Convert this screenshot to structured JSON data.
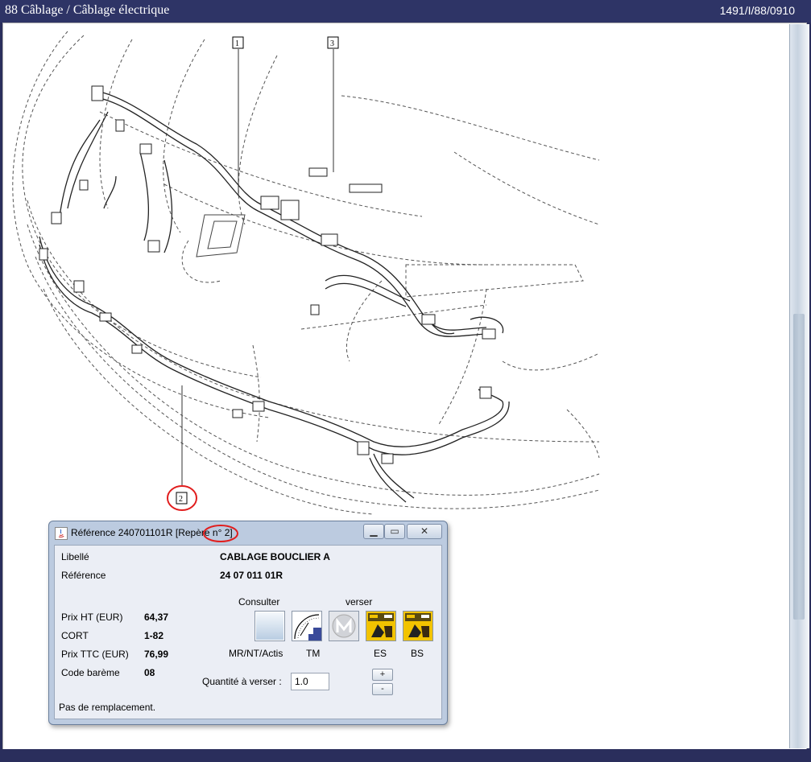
{
  "window": {
    "title_left": "88 Câblage / Câblage électrique",
    "title_right": "1491/I/88/0910"
  },
  "drawing": {
    "callouts": [
      "1",
      "2",
      "3"
    ],
    "highlight_color": "#e11d1d"
  },
  "dialog": {
    "title": "Référence 240701101R [Repère n° 2]",
    "fields": {
      "libelle_label": "Libellé",
      "libelle_value": "CABLAGE BOUCLIER A",
      "reference_label": "Référence",
      "reference_value": "24 07 011 01R",
      "prix_ht_label": "Prix HT (EUR)",
      "prix_ht_value": "64,37",
      "cort_label": "CORT",
      "cort_value": "1-82",
      "prix_ttc_label": "Prix TTC (EUR)",
      "prix_ttc_value": "76,99",
      "code_bareme_label": "Code barème",
      "code_bareme_value": "08"
    },
    "consulter_label": "Consulter",
    "verser_label": "verser",
    "buttons": [
      {
        "label": "MR/NT/Actis",
        "icon": "mr-nt-actis-icon"
      },
      {
        "label": "TM",
        "icon": "gauge-icon"
      },
      {
        "label": "",
        "icon": "disabled-logo-icon"
      },
      {
        "label": "ES",
        "icon": "es-icon"
      },
      {
        "label": "BS",
        "icon": "bs-icon"
      }
    ],
    "quantity_label": "Quantité à verser :",
    "quantity_value": "1.0",
    "plus_label": "+",
    "minus_label": "-",
    "footer": "Pas de remplacement."
  }
}
